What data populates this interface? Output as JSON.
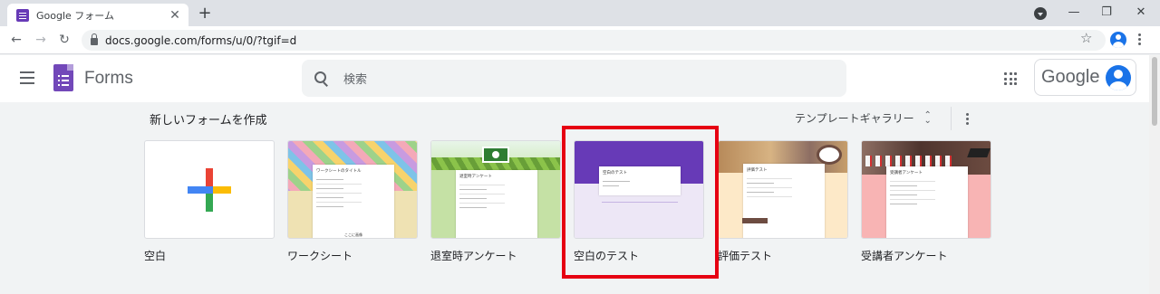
{
  "browser": {
    "tab_title": "Google フォーム",
    "tab_close": "✕",
    "new_tab": "+",
    "url": "docs.google.com/forms/u/0/?tgif=d",
    "back": "←",
    "forward": "→",
    "reload": "↻",
    "bookmark": "☆",
    "minimize": "—",
    "maximize": "❐",
    "close": "✕"
  },
  "header": {
    "app_name": "Forms",
    "search_placeholder": "検索",
    "google_label": "Google"
  },
  "templates_section": {
    "title": "新しいフォームを作成",
    "gallery_label": "テンプレートギャラリー",
    "updown": "⌃⌄"
  },
  "templates": [
    {
      "label": "空白"
    },
    {
      "label": "ワークシート",
      "heading": "ワークシートのタイトル",
      "footer": "ここに画像"
    },
    {
      "label": "退室時アンケート",
      "heading": "退室時アンケート"
    },
    {
      "label": "空白のテスト",
      "heading": "空白のテスト"
    },
    {
      "label": "評価テスト",
      "heading": "評価テスト"
    },
    {
      "label": "受講者アンケート",
      "heading": "受講者アンケート"
    }
  ],
  "colors": {
    "forms_purple": "#673ab7",
    "highlight_red": "#e60012"
  }
}
